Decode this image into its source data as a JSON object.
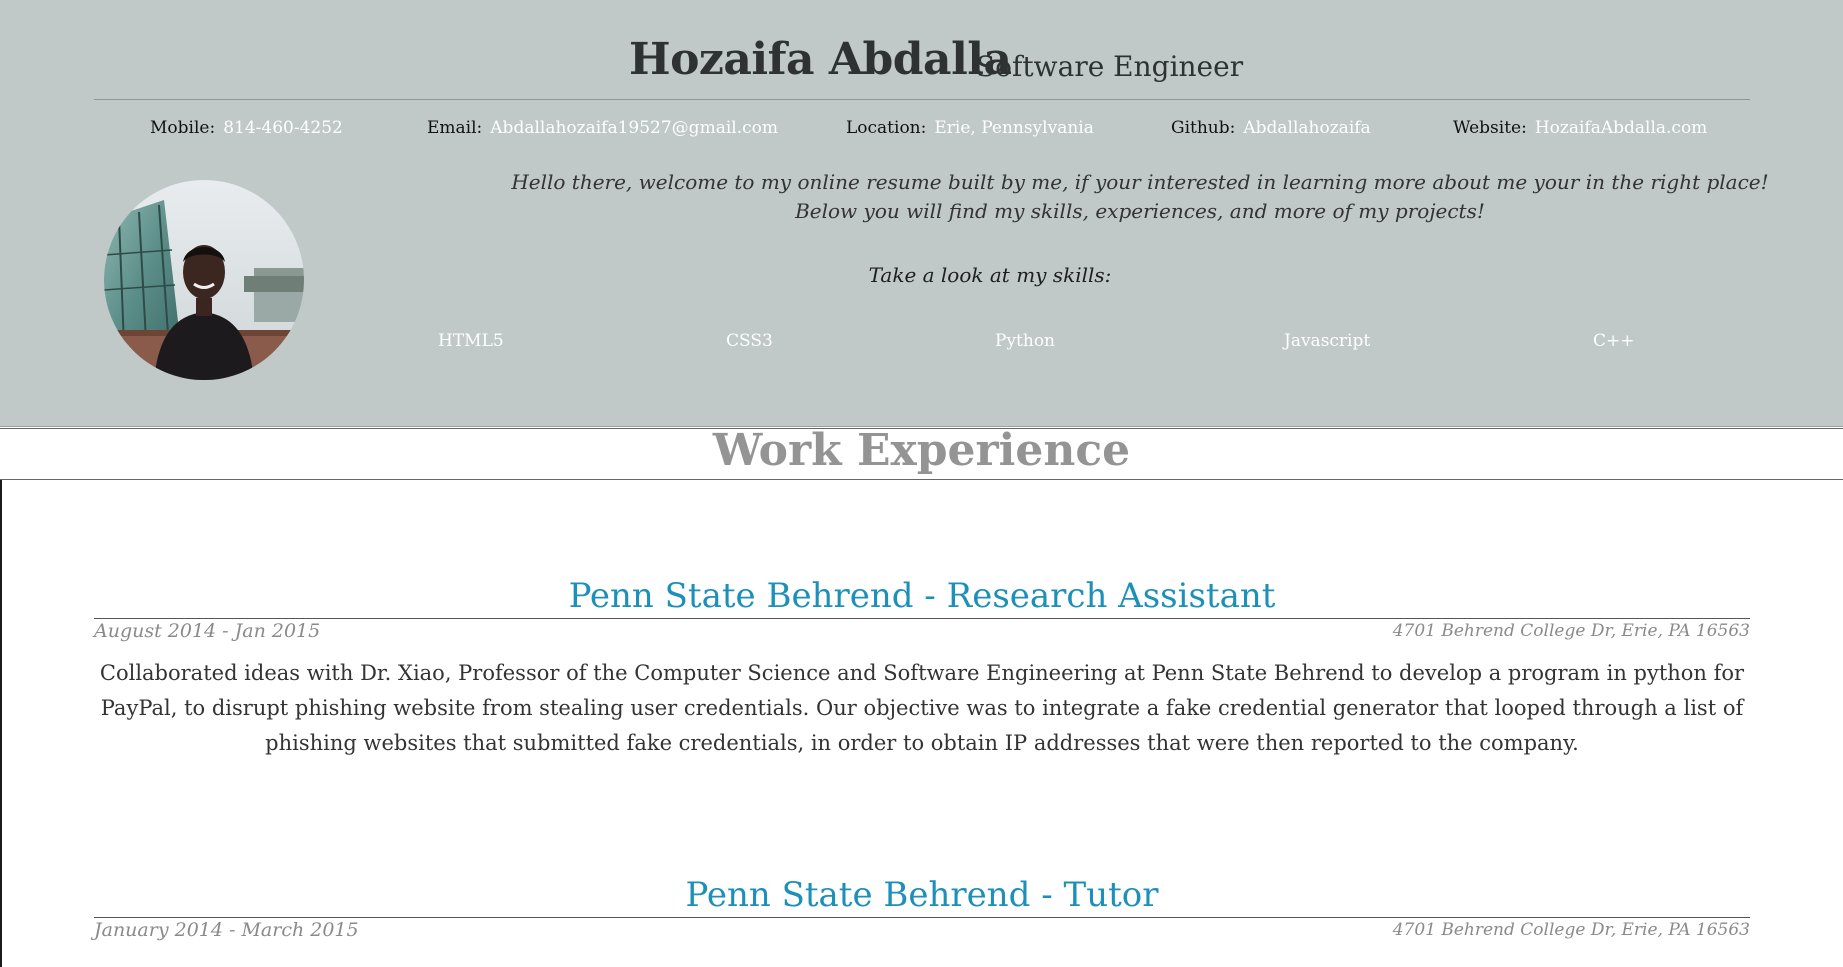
{
  "header": {
    "name": "Hozaifa Abdalla",
    "role": "Software Engineer"
  },
  "contact": [
    {
      "label": "Mobile:",
      "value": "814-460-4252"
    },
    {
      "label": "Email:",
      "value": "Abdallahozaifa19527@gmail.com"
    },
    {
      "label": "Location:",
      "value": "Erie, Pennsylvania"
    },
    {
      "label": "Github:",
      "value": "Abdallahozaifa"
    },
    {
      "label": "Website:",
      "value": "HozaifaAbdalla.com"
    }
  ],
  "intro": {
    "line1": "Hello there, welcome to my online resume built by me, if your interested in learning more about me your in the right place!",
    "line2": "Below you will find my skills, experiences, and more of my projects!"
  },
  "skills": {
    "title": "Take a look at my skills:",
    "items": [
      "HTML5",
      "CSS3",
      "Python",
      "Javascript",
      "C++"
    ]
  },
  "work": {
    "section_title": "Work Experience",
    "jobs": [
      {
        "title": "Penn State Behrend - Research Assistant",
        "dates": "August 2014 - Jan 2015",
        "address": "4701 Behrend College Dr, Erie, PA 16563",
        "description": "Collaborated ideas with Dr. Xiao, Professor of the Computer Science and Software Engineering at Penn State Behrend to develop a program in python for PayPal, to disrupt phishing website from stealing user credentials. Our objective was to integrate a fake credential generator that looped through a list of phishing websites that submitted fake credentials, in order to obtain IP addresses that were then reported to the company."
      },
      {
        "title": "Penn State Behrend - Tutor",
        "dates": "January 2014 - March 2015",
        "address": "4701 Behrend College Dr, Erie, PA 16563"
      }
    ]
  },
  "colors": {
    "hero_bg": "#c0c8c8",
    "job_title": "#1d90ba",
    "section_title": "#949494"
  }
}
